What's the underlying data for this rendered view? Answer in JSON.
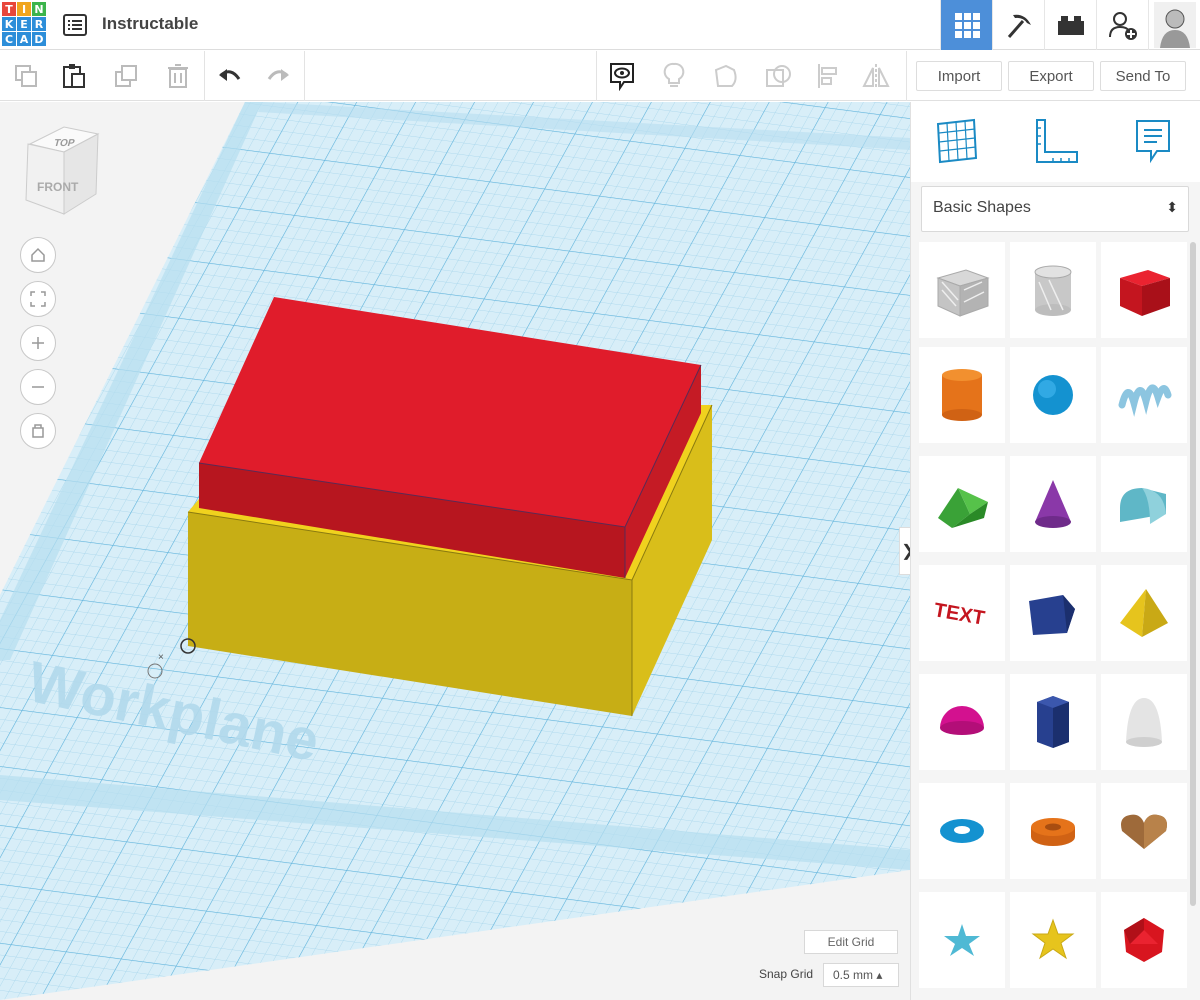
{
  "app": {
    "logo_letters": [
      "T",
      "I",
      "N",
      "K",
      "E",
      "R",
      "C",
      "A",
      "D"
    ],
    "logo_colors": [
      "#e8473b",
      "#e8473b",
      "#e8473b",
      "#2d8ed9",
      "#2d8ed9",
      "#2d8ed9",
      "#2d8ed9",
      "#2d8ed9",
      "#2d8ed9"
    ],
    "title": "Instructable"
  },
  "topbar": {
    "icons": [
      "3d-design-icon",
      "pickaxe-icon",
      "brick-icon",
      "add-user-icon",
      "user-avatar"
    ],
    "active": "3d-design-icon"
  },
  "toolbar": {
    "import_label": "Import",
    "export_label": "Export",
    "send_to_label": "Send To"
  },
  "viewcube": {
    "top": "TOP",
    "front": "FRONT"
  },
  "workplane": {
    "label": "Workplane"
  },
  "bottom": {
    "edit_grid_label": "Edit Grid",
    "snap_grid_label": "Snap Grid",
    "snap_grid_value": "0.5 mm ▴"
  },
  "sidebar": {
    "category": "Basic Shapes",
    "shapes": [
      "box-hole",
      "cylinder-hole",
      "box",
      "cylinder",
      "sphere",
      "scribble",
      "roof",
      "cone",
      "round-roof",
      "text",
      "wedge",
      "pyramid",
      "half-sphere",
      "polygon",
      "paraboloid",
      "torus",
      "tube",
      "heart",
      "star",
      "star-3d",
      "icosahedron"
    ]
  },
  "colors": {
    "accent": "#4d8fd9",
    "red": "#e01c2b",
    "yellow": "#d6b81a"
  }
}
